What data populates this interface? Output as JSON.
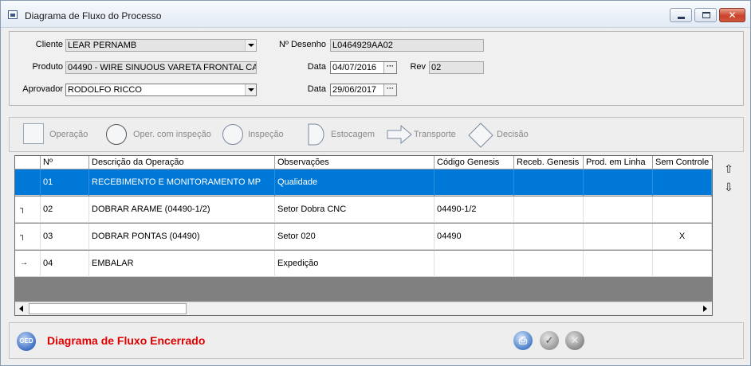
{
  "window": {
    "title": "Diagrama de Fluxo do Processo",
    "controls": {
      "minimize": "",
      "maximize": "",
      "close": "✕"
    }
  },
  "form": {
    "cliente_label": "Cliente",
    "cliente_value": "LEAR PERNAMB",
    "produto_label": "Produto",
    "produto_value": "04490 - WIRE SINUOUS VARETA FRONTAL CA",
    "aprovador_label": "Aprovador",
    "aprovador_value": "RODOLFO RICCO",
    "desenho_label": "Nº Desenho",
    "desenho_value": "L0464929AA02",
    "data1_label": "Data",
    "data1_value": "04/07/2016",
    "rev_label": "Rev",
    "rev_value": "02",
    "data2_label": "Data",
    "data2_value": "29/06/2017",
    "date_button": "···"
  },
  "legend": {
    "operacao": "Operação",
    "oper_inspecao": "Oper. com inspeção",
    "inspecao": "Inspeção",
    "estocagem": "Estocagem",
    "transporte": "Transporte",
    "decisao": "Decisão"
  },
  "grid": {
    "headers": [
      "",
      "Nº",
      "Descrição da Operação",
      "Observações",
      "Código Genesis",
      "Receb. Genesis",
      "Prod. em Linha",
      "Sem Controle T"
    ],
    "rows": [
      {
        "sym": "",
        "n": "01",
        "desc": "RECEBIMENTO E MONITORAMENTO MP",
        "obs": "Qualidade",
        "cod": "",
        "receb": "",
        "prod": "",
        "sem": ""
      },
      {
        "sym": "┐",
        "n": "02",
        "desc": "DOBRAR ARAME (04490-1/2)",
        "obs": "Setor Dobra CNC",
        "cod": "04490-1/2",
        "receb": "",
        "prod": "",
        "sem": ""
      },
      {
        "sym": "┐",
        "n": "03",
        "desc": "DOBRAR PONTAS (04490)",
        "obs": "Setor 020",
        "cod": "04490",
        "receb": "",
        "prod": "",
        "sem": "X"
      },
      {
        "sym": "→",
        "n": "04",
        "desc": "EMBALAR",
        "obs": "Expedição",
        "cod": "",
        "receb": "",
        "prod": "",
        "sem": ""
      }
    ],
    "move_up": "⇧",
    "move_down": "⇩"
  },
  "footer": {
    "ged_label": "GED",
    "status": "Diagrama de Fluxo Encerrado",
    "print_glyph": "⎙",
    "ok_glyph": "✓",
    "cancel_glyph": "✕"
  }
}
